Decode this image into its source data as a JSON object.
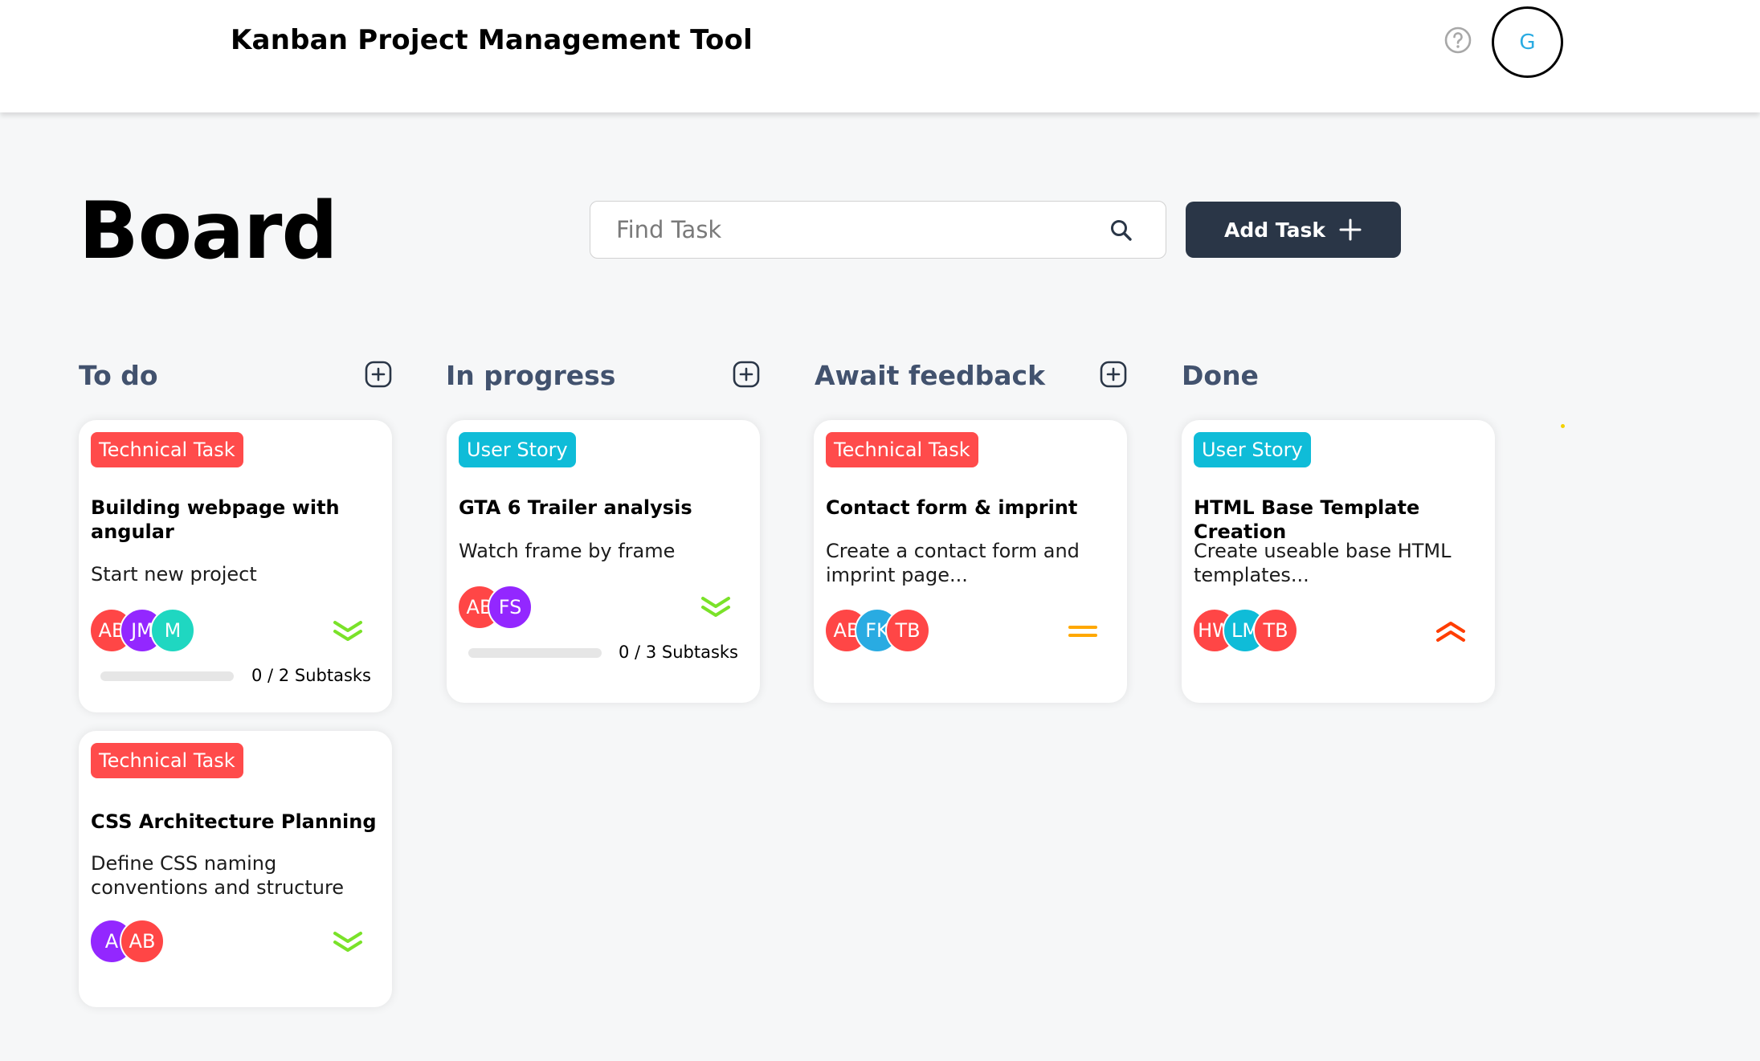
{
  "header": {
    "app_title": "Kanban Project Management Tool",
    "user_initial": "G"
  },
  "board": {
    "title": "Board",
    "search_placeholder": "Find Task",
    "search_value": "",
    "add_task_label": "Add Task"
  },
  "colors": {
    "technical_task": "#ff4b4b",
    "user_story": "#0fbcd8",
    "dark_button": "#2a3647",
    "priority_low": "#7ae229",
    "priority_medium": "#ffa800",
    "priority_urgent": "#ff3d00"
  },
  "columns": [
    {
      "label": "To do",
      "cards": [
        {
          "category": "Technical Task",
          "title": "Building webpage with angular",
          "description": "Start new project",
          "assignees": [
            {
              "initials": "AB",
              "color": "#ff4646"
            },
            {
              "initials": "JM",
              "color": "#9327ff"
            },
            {
              "initials": "M",
              "color": "#1fd7c1"
            }
          ],
          "priority": "low-icon",
          "subtasks_done": "0",
          "subtasks_total": "2",
          "subtasks_label": "Subtasks"
        },
        {
          "category": "Technical Task",
          "title": "CSS Architecture Planning",
          "description": "Define CSS naming conventions and structure",
          "assignees": [
            {
              "initials": "A",
              "color": "#9327ff"
            },
            {
              "initials": "AB",
              "color": "#ff4646"
            }
          ],
          "priority": "low-icon"
        }
      ]
    },
    {
      "label": "In progress",
      "cards": [
        {
          "category": "User Story",
          "title": "GTA 6 Trailer analysis",
          "description": "Watch frame by frame",
          "assignees": [
            {
              "initials": "AB",
              "color": "#ff4646"
            },
            {
              "initials": "FS",
              "color": "#9327ff"
            }
          ],
          "priority": "low-icon",
          "subtasks_done": "0",
          "subtasks_total": "3",
          "subtasks_label": "Subtasks"
        }
      ]
    },
    {
      "label": "Await feedback",
      "cards": [
        {
          "category": "Technical Task",
          "title": "Contact form & imprint",
          "description": "Create a contact form and imprint page...",
          "assignees": [
            {
              "initials": "AB",
              "color": "#ff4646"
            },
            {
              "initials": "FK",
              "color": "#29abe2"
            },
            {
              "initials": "TB",
              "color": "#ff4646"
            }
          ],
          "priority": "medium-icon"
        }
      ]
    },
    {
      "label": "Done",
      "cards": [
        {
          "category": "User Story",
          "title": "HTML Base Template Creation",
          "description": "Create useable base HTML templates...",
          "assignees": [
            {
              "initials": "HW",
              "color": "#ff4646"
            },
            {
              "initials": "LM",
              "color": "#0fbcd8"
            },
            {
              "initials": "TB",
              "color": "#ff4646"
            }
          ],
          "priority": "urgent-icon"
        }
      ]
    }
  ]
}
